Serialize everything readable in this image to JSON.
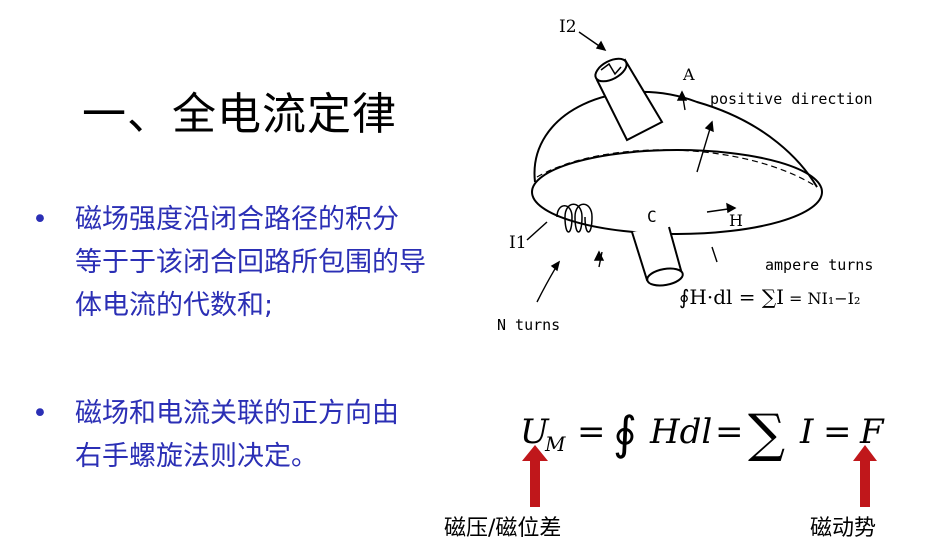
{
  "slide": {
    "title": "一、全电流定律",
    "bullets": [
      {
        "marker": "•",
        "lines": [
          "磁场强度沿闭合路径的积分",
          "等于于该闭合回路所包围的导",
          "体电流的代数和;"
        ]
      },
      {
        "marker": "•",
        "lines": [
          "磁场和电流关联的正方向由",
          "右手螺旋法则决定。"
        ]
      }
    ]
  },
  "figure": {
    "I2": "I2",
    "A": "A",
    "positive_direction": "positive direction",
    "C": "C",
    "H": "H",
    "I1": "I1",
    "ampere_turns": "ampere turns",
    "N_turns": "N turns",
    "formula_rhs": "= NI₁−I₂"
  },
  "equation": {
    "U": "U",
    "sub_M": "M",
    "mid": "Hdl",
    "I": "I",
    "F": "F"
  },
  "labels": {
    "left": "磁压/磁位差",
    "right": "磁动势"
  },
  "colors": {
    "title": "#000000",
    "bullet_text": "#2b2fb5",
    "arrow": "#c0171b"
  }
}
